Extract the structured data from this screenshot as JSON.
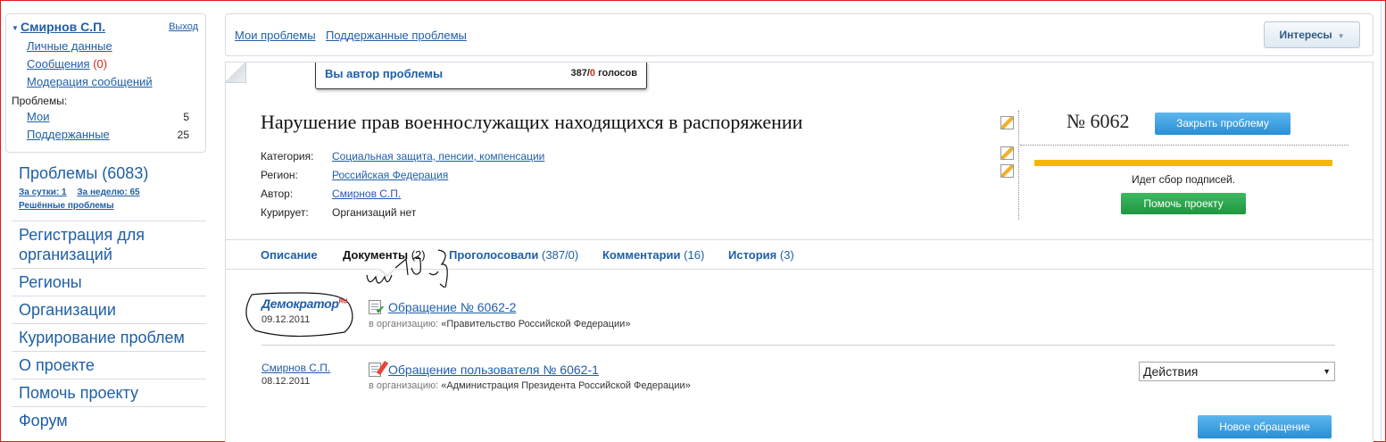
{
  "user": {
    "name": "Смирнов С.П.",
    "logout": "Выход",
    "links": [
      {
        "label": "Личные данные"
      },
      {
        "label": "Сообщения",
        "count": "(0)"
      },
      {
        "label": "Модерация сообщений"
      }
    ],
    "problems_label": "Проблемы:",
    "problems": [
      {
        "label": "Мои",
        "count": "5"
      },
      {
        "label": "Поддержанные",
        "count": "25"
      }
    ]
  },
  "left": {
    "problems_title": "Проблемы (6083)",
    "day": "За сутки: 1",
    "week": "За неделю: 65",
    "solved": "Решённые проблемы",
    "nav": [
      "Регистрация для организаций",
      "Регионы",
      "Организации",
      "Курирование проблем",
      "О проекте",
      "Помочь проекту",
      "Форум"
    ]
  },
  "topbar": {
    "my": "Мои проблемы",
    "supported": "Поддержанные проблемы",
    "interests": "Интересы"
  },
  "problem": {
    "author_note": "Вы автор проблемы",
    "votes_for": "387",
    "votes_sep": "/",
    "votes_against": "0",
    "votes_word": "голосов",
    "title": "Нарушение прав военнослужащих находящихся в распоряжении",
    "info": [
      {
        "label": "Категория:",
        "value": "Социальная защита, пенсии, компенсации",
        "link": true
      },
      {
        "label": "Регион:",
        "value": "Российская Федерация",
        "link": true
      },
      {
        "label": "Автор:",
        "value": "Смирнов С.П.",
        "link": true
      },
      {
        "label": "Курирует:",
        "value": "Организаций нет",
        "link": false
      }
    ],
    "number": "№ 6062",
    "close_btn": "Закрыть проблему",
    "progress": 1.0,
    "status": "Идет сбор подписей.",
    "help_btn": "Помочь проекту"
  },
  "tabs": [
    {
      "label": "Описание",
      "count": ""
    },
    {
      "label": "Документы",
      "count": "(2)",
      "active": true
    },
    {
      "label": "Проголосовали",
      "count": "(387/0)"
    },
    {
      "label": "Комментарии",
      "count": "(16)"
    },
    {
      "label": "История",
      "count": "(3)"
    }
  ],
  "documents": [
    {
      "author_logo": "Демократор",
      "logo_mark": "RU",
      "date": "09.12.2011",
      "title": "Обращение № 6062-2",
      "org_prefix": "в организацию:",
      "org": "«Правительство Российской Федерации»"
    },
    {
      "author": "Смирнов С.П.",
      "date": "08.12.2011",
      "title": "Обращение пользователя № 6062-1",
      "org_prefix": "в организацию:",
      "org": "«Администрация Президента Российской Федерации»"
    }
  ],
  "actions_select": "Действия",
  "new_request_btn": "Новое обращение",
  "colors": {
    "link": "#1f5fa6",
    "progress": "#f4b800",
    "button_blue": "#2a8fd4",
    "button_green": "#1f963f",
    "alert_red": "#d4261c"
  }
}
